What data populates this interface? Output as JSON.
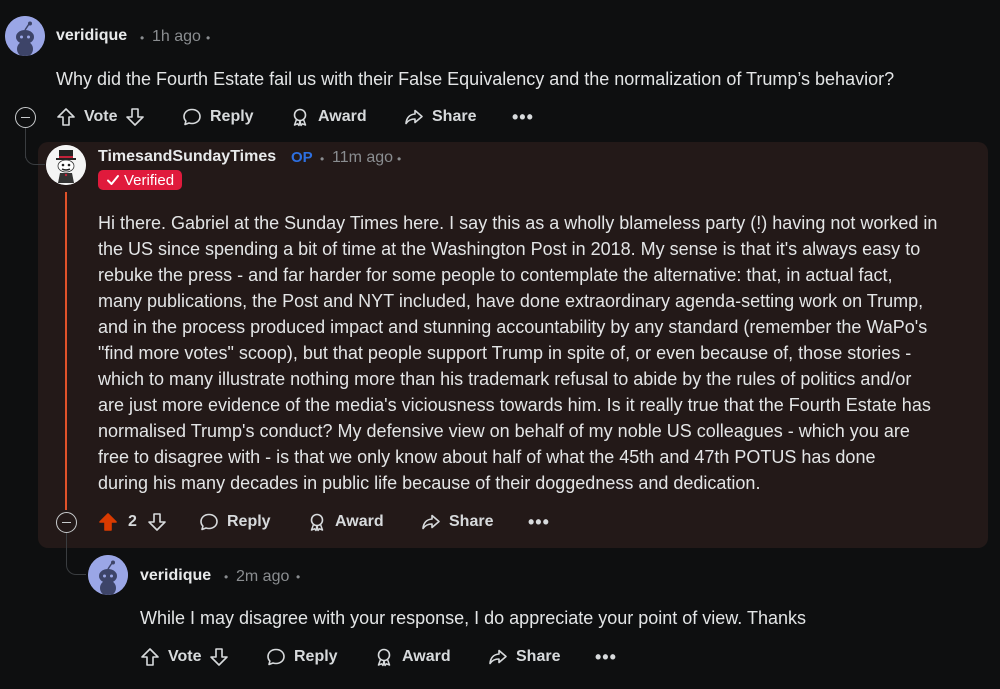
{
  "comments": [
    {
      "author": "veridique",
      "time": "1h ago",
      "text": "Why did the Fourth Estate fail us with their False Equivalency and the normalization of Trump’s behavior?",
      "vote_label": "Vote",
      "reply_label": "Reply",
      "award_label": "Award",
      "share_label": "Share"
    },
    {
      "author": "TimesandSundayTimes",
      "op_badge": "OP",
      "time": "11m ago",
      "verified_label": "Verified",
      "paragraph_lines": [
        "Hi there. Gabriel at the Sunday Times here. I say this as a wholly blameless party (!) having not worked in",
        "the US since spending a bit of time at the Washington Post in 2018. My sense is that it's always easy to",
        "rebuke the press - and far harder for some people to contemplate the alternative: that, in actual fact,",
        "many publications, the Post and NYT included, have done extraordinary agenda-setting work on Trump,",
        "and in the process produced impact and stunning accountability by any standard (remember the WaPo's",
        "\"find more votes\" scoop), but that people support Trump in spite of, or even because of, those stories -",
        "which to many illustrate nothing more than his trademark refusal to abide by the rules of politics and/or",
        "are just more evidence of the media's viciousness towards him. Is it really true that the Fourth Estate has",
        "normalised Trump's conduct? My defensive view on behalf of my noble US colleagues - which you are",
        "free to disagree with - is that we only know about half of what the 45th and 47th POTUS has done",
        "during his many decades in public life because of their doggedness and dedication."
      ],
      "vote_count": "2",
      "upvote_color": "#d93a00",
      "reply_label": "Reply",
      "award_label": "Award",
      "share_label": "Share"
    },
    {
      "author": "veridique",
      "time": "2m ago",
      "text": "While I may disagree with your response, I do appreciate your point of view. Thanks",
      "vote_label": "Vote",
      "reply_label": "Reply",
      "award_label": "Award",
      "share_label": "Share"
    }
  ],
  "icons": {
    "upvote": "arrow-up-icon",
    "downvote": "arrow-down-icon",
    "reply": "speech-bubble-icon",
    "award": "award-ribbon-icon",
    "share": "share-arrow-icon",
    "more": "ellipsis-icon",
    "collapse": "minus-circle-icon",
    "verified": "checkmark-icon"
  },
  "more_label": "•••"
}
